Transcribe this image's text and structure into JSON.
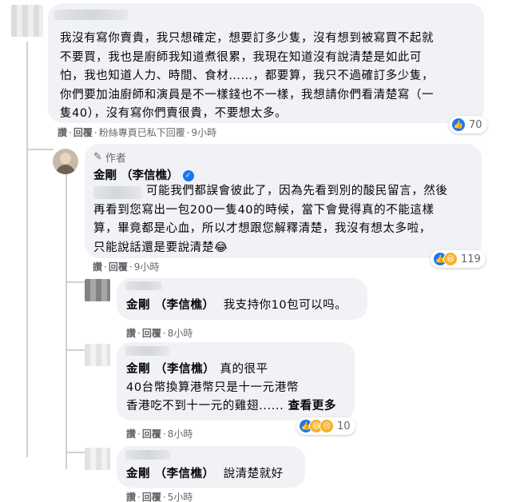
{
  "comments": [
    {
      "text": "我沒有寫你賣貴，我只想確定，想要訂多少隻，沒有想到被寫買不起就不要買，我也是廚師我知道煮很累，我現在知道沒有說清楚是如此可怕，我也知道人力、時間、食材……，都要算，我只不過確訂多少隻，你們要加油廚師和演員是不一樣錢也不一樣，我想請你們看清楚寫（一隻40），沒有寫你們賣很貴，不要想太多。",
      "lines": [
        "我沒有寫你賣貴，我只想確定，想要訂多少隻，沒有想到被寫買不起就",
        "不要買，我也是廚師我知道煮很累，我現在知道沒有說清楚是如此可",
        "怕，我也知道人力、時間、食材……，都要算，我只不過確訂多少隻，",
        "你們要加油廚師和演員是不一樣錢也不一樣，我想請你們看清楚寫（一",
        "隻40），沒有寫你們賣很貴，不要想太多。"
      ],
      "actions": {
        "like": "讚",
        "reply": "回覆",
        "note": "粉絲專頁已私下回覆",
        "time": "9小時"
      },
      "reaction_count": "70"
    }
  ],
  "author_reply": {
    "badge": "作者",
    "name": "金剛 （李信樵）",
    "lines": [
      "可能我們都誤會彼此了，因為先看到別的酸民留言，然後",
      "再看到您寫出一包200一隻40的時候，當下會覺得真的不能這樣",
      "算，畢竟都是心血，所以才想跟您解釋清楚，我沒有想太多啦，",
      "只能說話還是要說清楚"
    ],
    "emoji": "😂",
    "actions": {
      "like": "讚",
      "reply": "回覆",
      "time": "9小時"
    },
    "reaction_count": "119"
  },
  "replies": [
    {
      "tag": "金剛 （李信樵）",
      "text": "我支持你10包可以吗。",
      "actions": {
        "like": "讚",
        "reply": "回覆",
        "time": "8小時"
      }
    },
    {
      "tag": "金剛 （李信樵）",
      "line1": "真的很平",
      "line2": "40台幣換算港幣只是十一元港幣",
      "line3": "香港吃不到十一元的雞翅......",
      "see_more": "查看更多",
      "actions": {
        "like": "讚",
        "reply": "回覆",
        "time": "8小時"
      },
      "reaction_count": "10"
    },
    {
      "tag": "金剛 （李信樵）",
      "text": "說清楚就好",
      "actions": {
        "like": "讚",
        "reply": "回覆",
        "time": "5小時"
      }
    }
  ],
  "colors": {
    "bubble": "#f0f2f5",
    "secondary_text": "#65676b",
    "like_blue": "#1877f2"
  }
}
